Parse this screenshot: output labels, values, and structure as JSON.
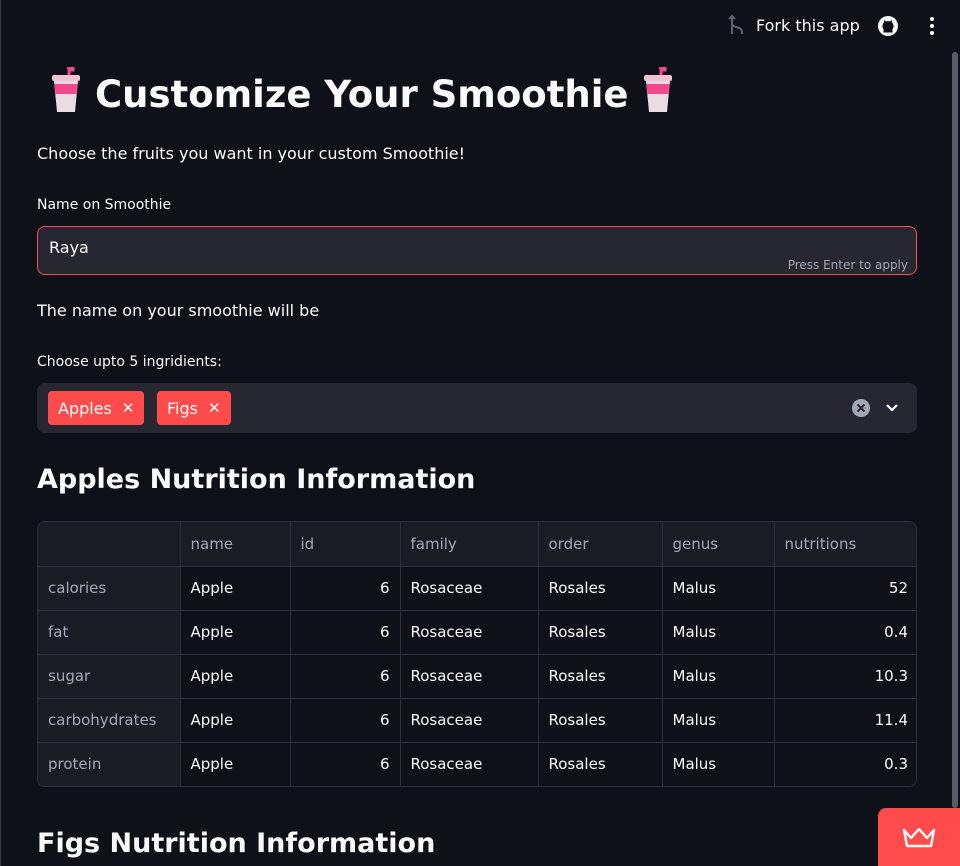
{
  "toolbar": {
    "fork_label": "Fork this app"
  },
  "header": {
    "title": "Customize Your Smoothie",
    "emoji": "cup-with-straw-icon"
  },
  "subtitle": "Choose the fruits you want in your custom Smoothie!",
  "name_field": {
    "label": "Name on Smoothie",
    "value": "Raya",
    "hint": "Press Enter to apply"
  },
  "name_line": "The name on your smoothie will be",
  "ingredients": {
    "label": "Choose upto 5 ingridients:",
    "selected": [
      "Apples",
      "Figs"
    ]
  },
  "apples_section": {
    "heading": "Apples Nutrition Information",
    "columns": [
      "",
      "name",
      "id",
      "family",
      "order",
      "genus",
      "nutritions"
    ],
    "rows": [
      [
        "calories",
        "Apple",
        "6",
        "Rosaceae",
        "Rosales",
        "Malus",
        "52"
      ],
      [
        "fat",
        "Apple",
        "6",
        "Rosaceae",
        "Rosales",
        "Malus",
        "0.4"
      ],
      [
        "sugar",
        "Apple",
        "6",
        "Rosaceae",
        "Rosales",
        "Malus",
        "10.3"
      ],
      [
        "carbohydrates",
        "Apple",
        "6",
        "Rosaceae",
        "Rosales",
        "Malus",
        "11.4"
      ],
      [
        "protein",
        "Apple",
        "6",
        "Rosaceae",
        "Rosales",
        "Malus",
        "0.3"
      ]
    ]
  },
  "figs_section": {
    "heading": "Figs Nutrition Information"
  },
  "colors": {
    "accent": "#ff4b4b",
    "background": "#0e1117",
    "widget_bg": "#262730"
  }
}
